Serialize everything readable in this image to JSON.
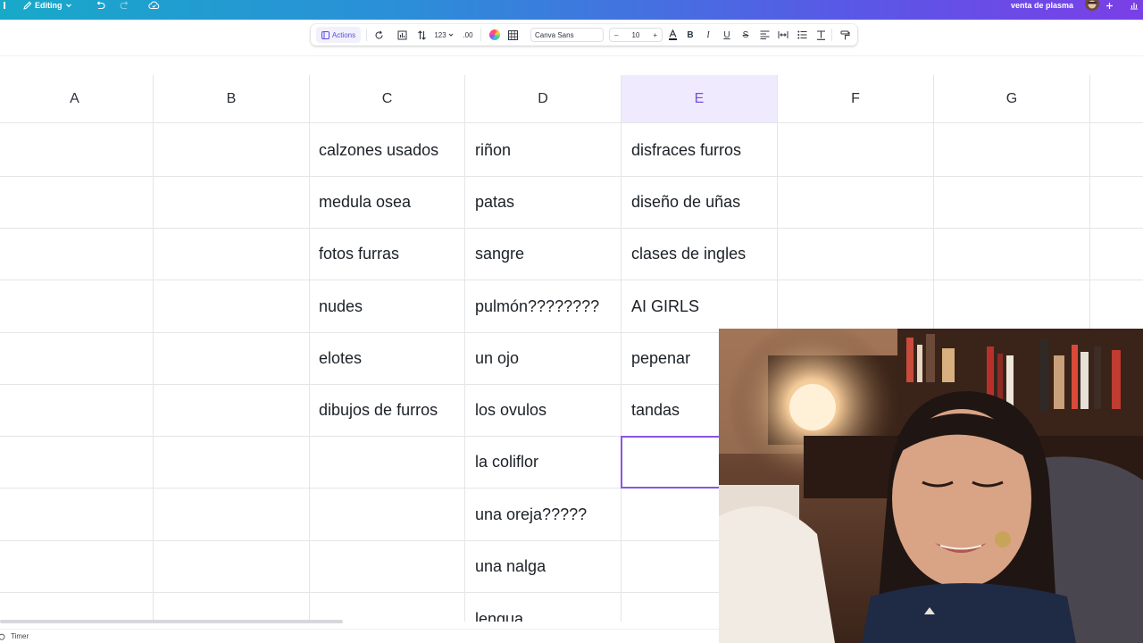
{
  "topbar": {
    "editing_label": "Editing",
    "doc_title": "venta de plasma"
  },
  "toolbar": {
    "actions_label": "Actions",
    "number_format": "123",
    "decimals": ".00",
    "font_name": "Canva Sans",
    "font_size": "10",
    "minus": "–",
    "plus": "+",
    "bold": "B",
    "italic": "I",
    "underline": "U",
    "strike": "S"
  },
  "columns": [
    "A",
    "B",
    "C",
    "D",
    "E",
    "F",
    "G"
  ],
  "selected_column": "E",
  "cells": {
    "C": [
      "calzones usados",
      "medula osea",
      "fotos furras",
      "nudes",
      "elotes",
      "dibujos de furros",
      "",
      "",
      "",
      ""
    ],
    "D": [
      "riñon",
      "patas",
      "sangre",
      "pulmón????????",
      "un ojo",
      "los ovulos",
      "la coliflor",
      "una oreja?????",
      "una nalga",
      "lengua"
    ],
    "E": [
      "disfraces furros",
      "diseño de uñas",
      "clases de ingles",
      "AI GIRLS",
      "pepenar",
      "tandas",
      "",
      "",
      "",
      ""
    ]
  },
  "bottombar": {
    "timer_label": "Timer"
  },
  "colors": {
    "accent": "#8a55e4",
    "selected_header_bg": "#efeafd",
    "grid_line": "#e3e5e8"
  }
}
